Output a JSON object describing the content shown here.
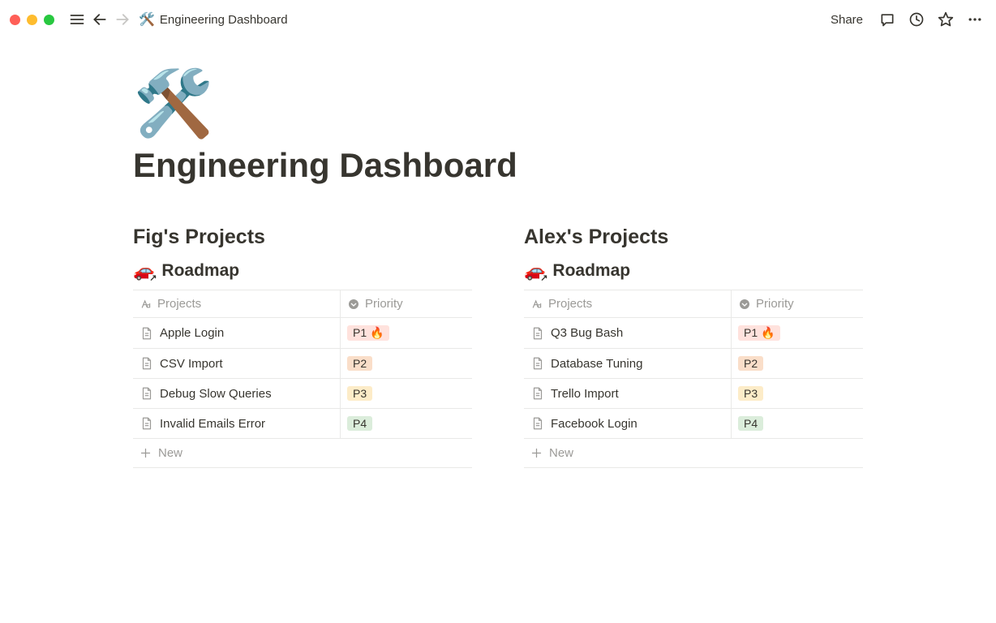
{
  "breadcrumb": {
    "icon": "hammer-wrench",
    "title": "Engineering Dashboard"
  },
  "topbar": {
    "share_label": "Share"
  },
  "page": {
    "icon_emoji": "🛠️",
    "title": "Engineering Dashboard"
  },
  "columns": [
    {
      "section_title": "Fig's Projects",
      "database": {
        "emoji": "🚗",
        "title": "Roadmap",
        "columns": {
          "projects_label": "Projects",
          "priority_label": "Priority"
        },
        "rows": [
          {
            "name": "Apple Login",
            "priority": "P1 🔥",
            "priority_class": "p1"
          },
          {
            "name": "CSV Import",
            "priority": "P2",
            "priority_class": "p2"
          },
          {
            "name": "Debug Slow Queries",
            "priority": "P3",
            "priority_class": "p3"
          },
          {
            "name": "Invalid Emails Error",
            "priority": "P4",
            "priority_class": "p4"
          }
        ],
        "new_label": "New"
      }
    },
    {
      "section_title": "Alex's Projects",
      "database": {
        "emoji": "🚗",
        "title": "Roadmap",
        "columns": {
          "projects_label": "Projects",
          "priority_label": "Priority"
        },
        "rows": [
          {
            "name": "Q3 Bug Bash",
            "priority": "P1 🔥",
            "priority_class": "p1"
          },
          {
            "name": "Database Tuning",
            "priority": "P2",
            "priority_class": "p2"
          },
          {
            "name": "Trello Import",
            "priority": "P3",
            "priority_class": "p3"
          },
          {
            "name": "Facebook Login",
            "priority": "P4",
            "priority_class": "p4"
          }
        ],
        "new_label": "New"
      }
    }
  ]
}
